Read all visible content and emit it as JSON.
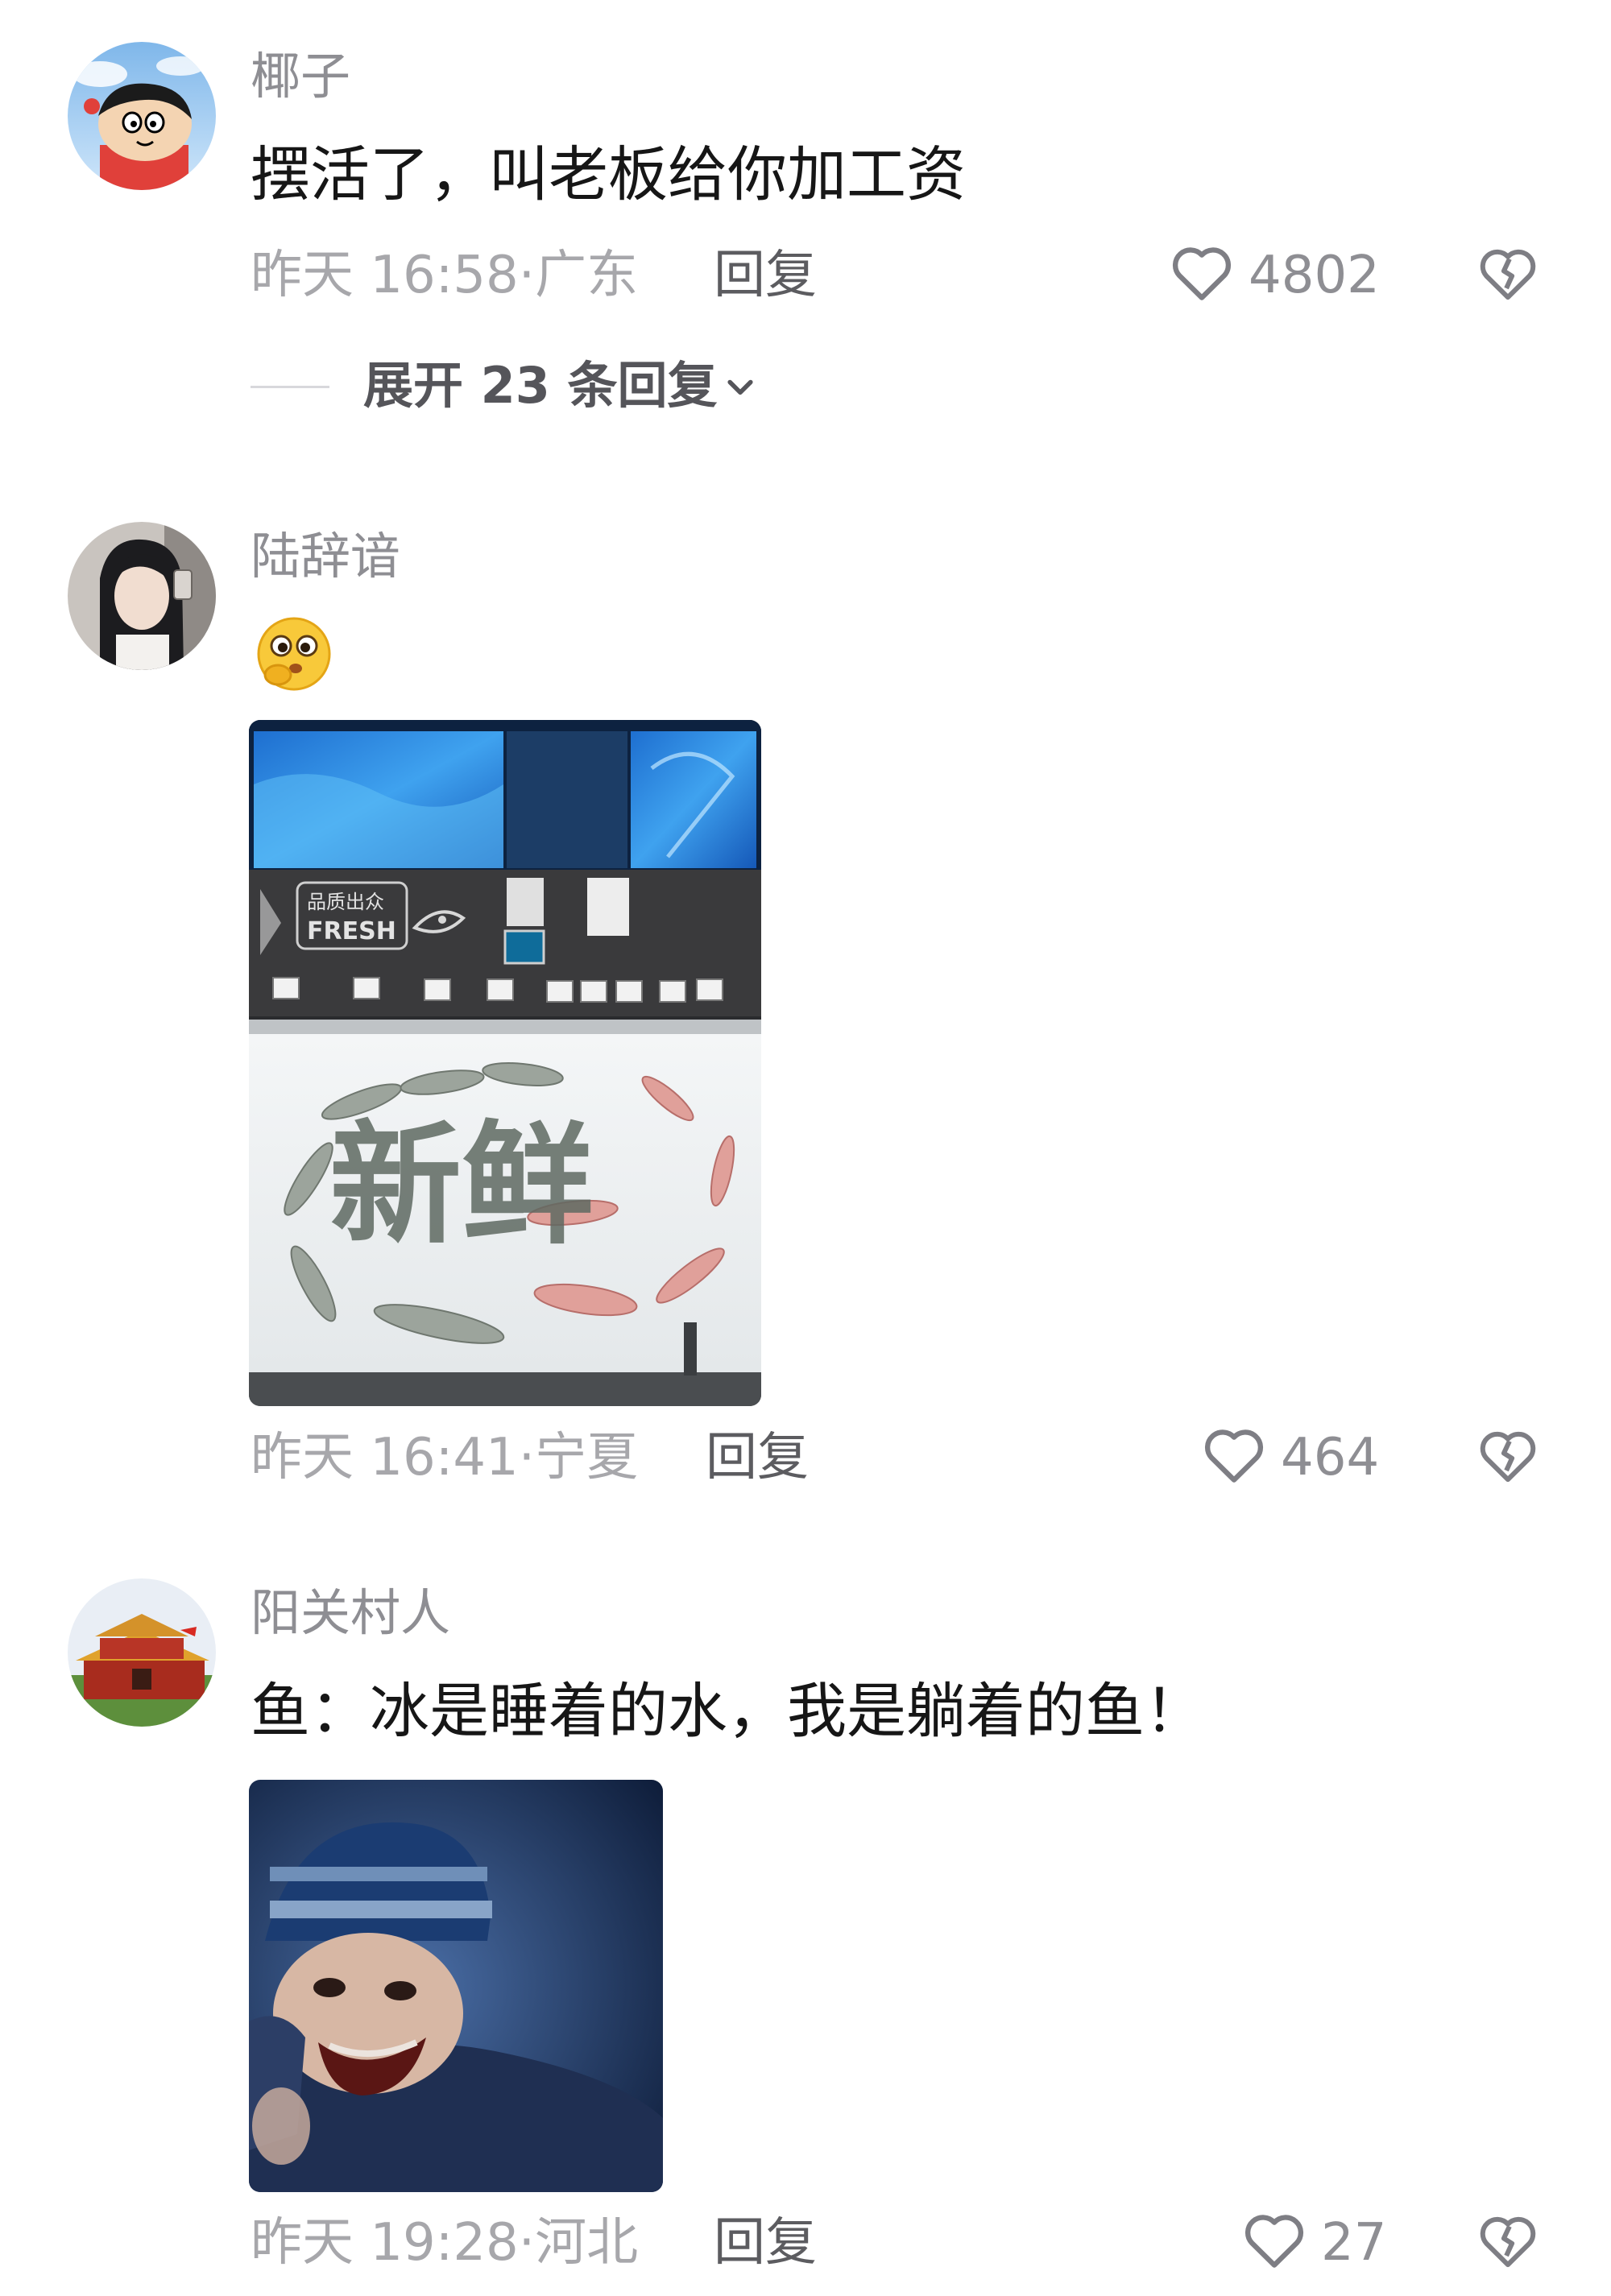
{
  "comments": [
    {
      "username": "椰子",
      "text": "摆活了，叫老板给你加工资",
      "time": "昨天 16:58",
      "location": "广东",
      "reply_label": "回复",
      "likes": "4802",
      "expand_label": "展开 23 条回复"
    },
    {
      "username": "陆辞谙",
      "time": "昨天 16:41",
      "location": "宁夏",
      "reply_label": "回复",
      "likes": "464",
      "image_signs": {
        "sign_top": "品质出众",
        "sign_bottom": "FRESH",
        "ice_text": "新鲜"
      }
    },
    {
      "username": "阳关村人",
      "text": "鱼：冰是睡着的水，我是躺着的鱼！",
      "time": "昨天 19:28",
      "location": "河北",
      "reply_label": "回复",
      "likes": "27"
    }
  ],
  "separator": "·",
  "icons": {
    "like": "heart-outline-icon",
    "dislike": "broken-heart-icon",
    "expand": "chevron-down-icon"
  },
  "colors": {
    "username": "#8e8e93",
    "text": "#161616",
    "meta": "#a7a7ab"
  }
}
